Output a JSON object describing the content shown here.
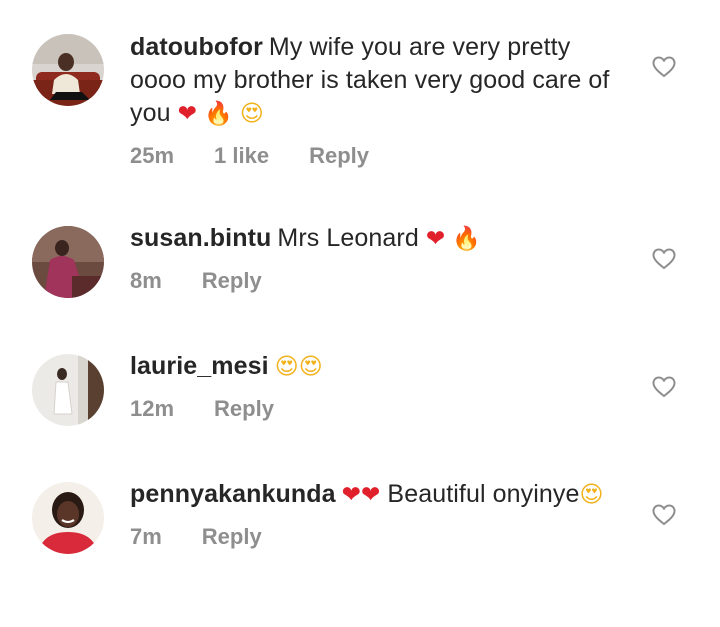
{
  "comments": [
    {
      "username": "datoubofor",
      "text": "My wife you are very pretty oooo my brother is taken very good care of you",
      "emojis": [
        "❤",
        "🔥",
        "😍"
      ],
      "time": "25m",
      "likes": "1 like",
      "reply": "Reply",
      "avatar_icon": "avatar-man-on-red-couch"
    },
    {
      "username": "susan.bintu",
      "text": "Mrs Leonard",
      "emojis": [
        "❤",
        "🔥"
      ],
      "time": "8m",
      "reply": "Reply",
      "avatar_icon": "avatar-woman-pink-dress"
    },
    {
      "username": "laurie_mesi",
      "text": "",
      "emojis": [
        "😍",
        "😍"
      ],
      "time": "12m",
      "reply": "Reply",
      "avatar_icon": "avatar-woman-white-dress"
    },
    {
      "username": "pennyakankunda",
      "text_before": "",
      "emojis_before": [
        "❤",
        "❤"
      ],
      "text": "Beautiful onyinye",
      "emojis": [
        "😍"
      ],
      "time": "7m",
      "reply": "Reply",
      "avatar_icon": "avatar-woman-red-top"
    }
  ],
  "colors": {
    "meta_gray": "#8e8e8e",
    "text": "#262626",
    "heart_icon_stroke": "#8e8e8e"
  }
}
